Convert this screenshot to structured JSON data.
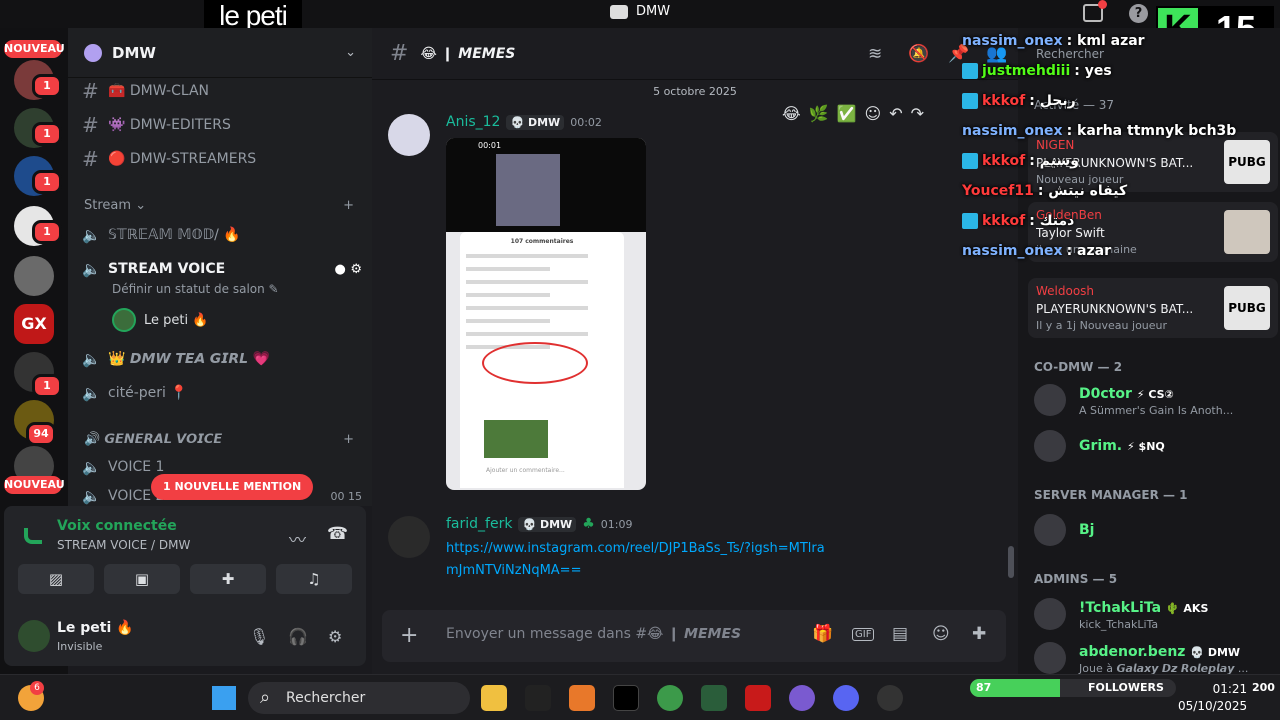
{
  "stream_overlay": {
    "tag": "le peti",
    "k_letter": "K",
    "k_number": "15"
  },
  "window": {
    "title": "DMW"
  },
  "server_rail": {
    "nouveau_top": "NOUVEAU",
    "nouveau_bottom": "NOUVEAU",
    "badges": [
      "1",
      "1",
      "1",
      "1",
      "1",
      "1",
      "94"
    ],
    "gx_label": "GX"
  },
  "sidebar": {
    "guild_name": "DMW",
    "channels": [
      {
        "name": "🧰 DMW-CLAN"
      },
      {
        "name": "👾 DMW-EDITERS"
      },
      {
        "name": "🔴 DMW-STREAMERS"
      }
    ],
    "category_stream": "Stream",
    "voice_channels": {
      "stream_mod": "𝕊𝕋ℝ𝔼𝔸𝕄 𝕄𝕆𝔻/ 🔥",
      "stream_voice": "STREAM VOICE",
      "stream_voice_status": "Définir un statut de salon ✎",
      "user_in_voice": "Le peti 🔥",
      "tea_girl": "👑 𝘿𝙈𝙒 𝙏𝙀𝘼 𝙂𝙄𝙍𝙇 💗",
      "cite_peri": "cité-peri 📍"
    },
    "category_general": "🔊 𝙂𝙀𝙉𝙀𝙍𝘼𝙇 𝙑𝙊𝙄𝘾𝙀",
    "voice_1": "VOICE 1",
    "voice_2": "VOICE 2",
    "voice_2_counts": "00  15",
    "mention_pill": "1 NOUVELLE MENTION"
  },
  "voice_panel": {
    "status": "Voix connectée",
    "location": "STREAM VOICE / DMW"
  },
  "user_panel": {
    "name": "Le peti 🔥",
    "status": "Invisible"
  },
  "chat": {
    "channel_title": "😂 ❙ 𝙈𝙀𝙈𝙀𝙎",
    "date_separator": "5 octobre 2025",
    "messages": [
      {
        "author": "Anis_12",
        "tag": "💀 DMW",
        "time": "00:02",
        "author_color": "#1abc9c"
      },
      {
        "author": "farid_ferk",
        "tag": "💀 DMW",
        "time": "01:09",
        "author_color": "#1abc9c",
        "link": "https://www.instagram.com/reel/DJP1BaSs_Ts/?igsh=MTlramJmNTViNzNqMA=="
      }
    ],
    "attachment": {
      "status_time": "00:01",
      "comments_header": "107 commentaires",
      "comment_input": "Ajouter un commentaire..."
    },
    "composer_placeholder": "Envoyer un message dans #😂 ❙ 𝙈𝙀𝙈𝙀𝙎"
  },
  "members": {
    "search_placeholder": "Rechercher",
    "activity_header": "Activité — 37",
    "activities": [
      {
        "user": "NIGEN",
        "game": "PLAYERUNKNOWN'S BAT...",
        "sub": "Nouveau joueur",
        "art": "PUBG"
      },
      {
        "user": "GoldenBen",
        "game": "Taylor Swift",
        "sub": "il y a une semaine",
        "art": ""
      },
      {
        "user": "Weldoosh",
        "game": "PLAYERUNKNOWN'S BAT...",
        "sub": "Il y a 1j  Nouveau joueur",
        "art": "PUBG"
      }
    ],
    "groups": [
      {
        "title": "CO-DMW — 2",
        "members": [
          {
            "name": "D0ctor",
            "tag": "⚡ CS②",
            "sub": "A Sümmer's Gain Is Anoth...",
            "color": "#57f287"
          },
          {
            "name": "Grim.",
            "tag": "⚡ $NQ",
            "sub": "",
            "color": "#57f287"
          }
        ]
      },
      {
        "title": "SERVER MANAGER — 1",
        "members": [
          {
            "name": "Bj",
            "tag": "",
            "sub": "",
            "color": "#57f287"
          }
        ]
      },
      {
        "title": "ADMINS — 5",
        "members": [
          {
            "name": "!TchakLiTa",
            "tag": "🌵 AKS",
            "sub": "kick_TchakLiTa",
            "color": "#57f287"
          },
          {
            "name": "abdenor.benz",
            "tag": "💀 DMW",
            "sub": "Joue à 𝙂𝙖𝙡𝙖𝙭𝙮 𝘿𝙯 𝙍𝙤𝙡𝙚𝙥𝙡𝙖𝙮 ...",
            "color": "#57f287"
          }
        ]
      }
    ]
  },
  "chat_overlay": [
    {
      "user": "nassim_onex",
      "text": " : kml azar",
      "color": "#7fb2ff",
      "platform": ""
    },
    {
      "user": "justmehdiii",
      "text": " : yes",
      "color": "#53fc18",
      "platform": "tw"
    },
    {
      "user": "kkkof",
      "text": " : ربحل",
      "color": "#ff3b3b",
      "platform": "tw"
    },
    {
      "user": "nassim_onex",
      "text": " : karha ttmnyk bch3b",
      "color": "#7fb2ff",
      "platform": ""
    },
    {
      "user": "kkkof",
      "text": " : وسيم",
      "color": "#ff3b3b",
      "platform": "tw"
    },
    {
      "user": "Youcef11",
      "text": " : كيفاه نيتش",
      "color": "#ff3b3b",
      "platform": ""
    },
    {
      "user": "kkkof",
      "text": " : دمتك",
      "color": "#ff3b3b",
      "platform": "tw"
    },
    {
      "user": "nassim_onex",
      "text": " : azar",
      "color": "#7fb2ff",
      "platform": ""
    }
  ],
  "taskbar": {
    "search_label": "Rechercher",
    "weather_badge": "6",
    "followers_label": "FOLLOWERS",
    "followers_current": "87",
    "followers_goal": "200",
    "followers_progress": 0.435,
    "time": "01:21",
    "date": "05/10/2025"
  }
}
